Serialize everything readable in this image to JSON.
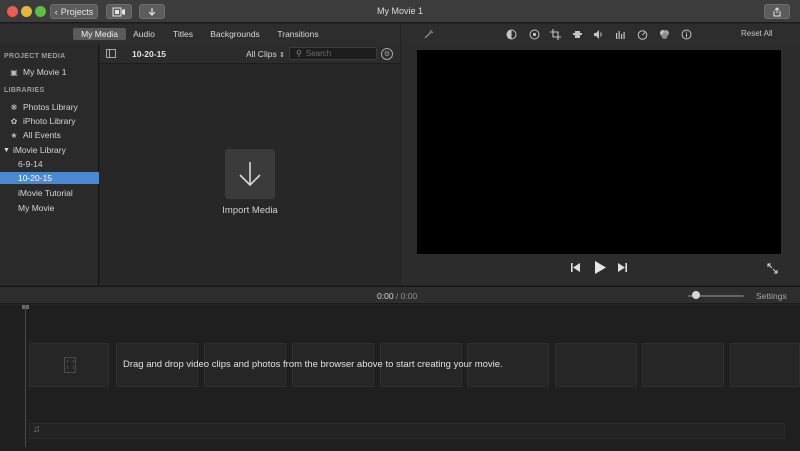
{
  "window": {
    "title": "My Movie 1",
    "projects_label": "Projects"
  },
  "browser_tabs": [
    {
      "label": "My Media",
      "active": true
    },
    {
      "label": "Audio",
      "active": false
    },
    {
      "label": "Titles",
      "active": false
    },
    {
      "label": "Backgrounds",
      "active": false
    },
    {
      "label": "Transitions",
      "active": false
    }
  ],
  "sidebar": {
    "project_media_header": "PROJECT MEDIA",
    "project_item": "My Movie 1",
    "libraries_header": "LIBRARIES",
    "libraries": [
      {
        "label": "Photos Library",
        "icon": "photos-icon"
      },
      {
        "label": "iPhoto Library",
        "icon": "iphoto-icon"
      },
      {
        "label": "All Events",
        "icon": "star-icon"
      }
    ],
    "imovie_library": "iMovie Library",
    "events": [
      {
        "label": "6-9-14",
        "selected": false
      },
      {
        "label": "10-20-15",
        "selected": true
      },
      {
        "label": "iMovie Tutorial",
        "selected": false
      },
      {
        "label": "My Movie",
        "selected": false
      }
    ]
  },
  "browser": {
    "event_name": "10-20-15",
    "clips_filter": "All Clips",
    "search_placeholder": "Search",
    "import_label": "Import Media"
  },
  "viewer_tools": {
    "reset_all": "Reset All",
    "icons": [
      "magic-wand-icon",
      "color-balance-icon",
      "color-correction-icon",
      "crop-icon",
      "stabilization-icon",
      "volume-icon",
      "equalizer-icon",
      "speed-icon",
      "filter-icon",
      "info-icon"
    ]
  },
  "timeline": {
    "current_time": "0:00",
    "separator": "/",
    "total_time": "0:00",
    "settings_label": "Settings",
    "zoom_level": 0.15,
    "drop_message": "Drag and drop video clips and photos from the browser above to start creating your movie."
  },
  "colors": {
    "selection": "#4a89d1",
    "background": "#242424"
  }
}
